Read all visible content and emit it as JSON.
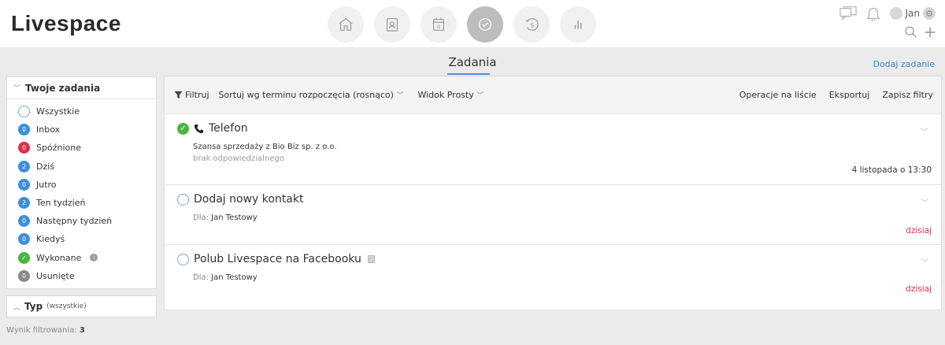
{
  "header": {
    "logo": "Livespace",
    "nav": [
      {
        "icon": "home-icon",
        "active": false
      },
      {
        "icon": "contacts-icon",
        "active": false
      },
      {
        "icon": "calendar-icon",
        "active": false,
        "label": "8"
      },
      {
        "icon": "tasks-check-icon",
        "active": true
      },
      {
        "icon": "deals-money-icon",
        "active": false
      },
      {
        "icon": "reports-chart-icon",
        "active": false
      }
    ],
    "user_name": "Jan"
  },
  "page": {
    "title": "Zadania",
    "add_task": "Dodaj zadanie"
  },
  "sidebar": {
    "heading": "Twoje zadania",
    "items": [
      {
        "label": "Wszystkie",
        "count": "",
        "badge": "empty"
      },
      {
        "label": "Inbox",
        "count": "0",
        "badge": "blue"
      },
      {
        "label": "Spóźnione",
        "count": "0",
        "badge": "red"
      },
      {
        "label": "Dziś",
        "count": "2",
        "badge": "blue"
      },
      {
        "label": "Jutro",
        "count": "0",
        "badge": "blue"
      },
      {
        "label": "Ten tydzień",
        "count": "2",
        "badge": "blue"
      },
      {
        "label": "Następny tydzień",
        "count": "0",
        "badge": "blue"
      },
      {
        "label": "Kiedyś",
        "count": "0",
        "badge": "blue"
      },
      {
        "label": "Wykonane",
        "count": "✓",
        "badge": "green"
      },
      {
        "label": "Usunięte",
        "count": "0",
        "badge": "gray"
      }
    ],
    "type_label": "Typ",
    "type_sub": "(wszystkie)",
    "result_label": "Wynik filtrowania:",
    "result_count": "3"
  },
  "toolbar": {
    "filter": "Filtruj",
    "sort": "Sortuj wg terminu rozpoczęcia (rosnąco)",
    "view": "Widok Prosty",
    "list_ops": "Operacje na liście",
    "export": "Eksportuj",
    "save_filters": "Zapisz filtry"
  },
  "tasks": [
    {
      "title": "Telefon",
      "done": true,
      "line1": "Szansa sprzedaży z Bio Biz sp. z o.o.",
      "line2": "brak odpowiedzialnego",
      "date": "4 listopada o 13:30"
    },
    {
      "title": "Dodaj nowy kontakt",
      "done": false,
      "for_label": "Dla:",
      "for_name": "Jan Testowy",
      "date": "dzisiaj"
    },
    {
      "title": "Polub Livespace na Facebooku",
      "done": false,
      "for_label": "Dla:",
      "for_name": "Jan Testowy",
      "date": "dzisiaj"
    }
  ],
  "colors": {
    "accent": "#3d8fd8",
    "overdue": "#d9304a",
    "done": "#4bb543"
  }
}
